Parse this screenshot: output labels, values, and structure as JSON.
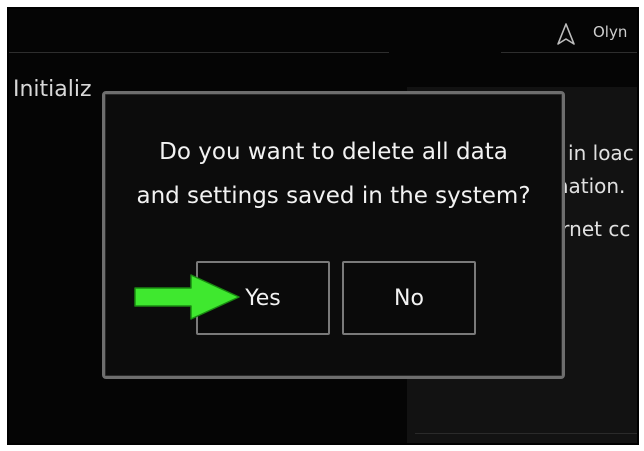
{
  "header": {
    "navigation_icon": "navigation-arrow-icon",
    "user_name": "Olyn"
  },
  "page": {
    "title": "Initializ"
  },
  "background_text": {
    "line1": "d in loac",
    "line2": "mation.",
    "line3": "ernet cc"
  },
  "dialog": {
    "message_line1": "Do you want to delete all data",
    "message_line2": "and settings saved in the system?",
    "yes_label": "Yes",
    "no_label": "No"
  },
  "annotation": {
    "arrow_icon": "green-arrow-icon",
    "arrow_color": "#3fe82f"
  }
}
